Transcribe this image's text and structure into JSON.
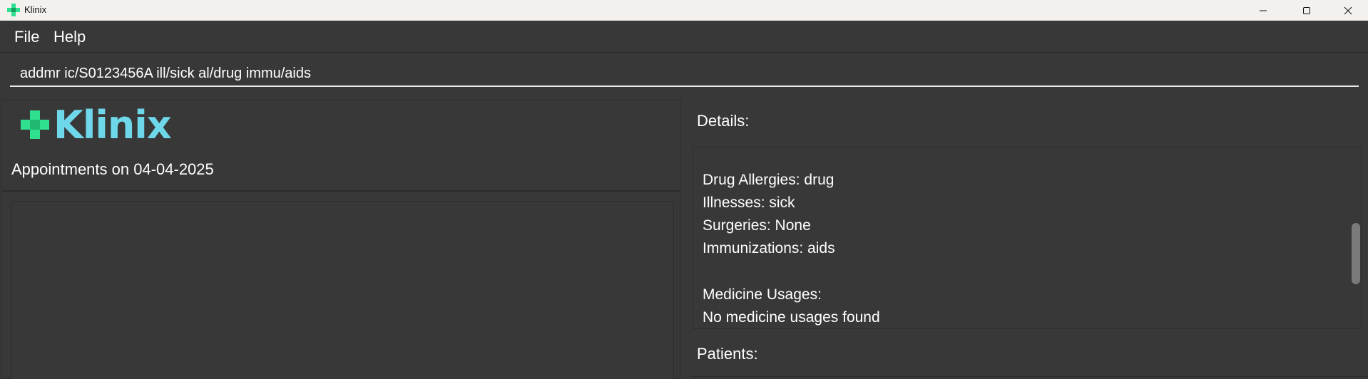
{
  "window": {
    "title": "Klinix",
    "icon": "green-plus-icon",
    "controls": [
      "minimize-icon",
      "maximize-icon",
      "close-icon"
    ]
  },
  "menu": {
    "items": [
      {
        "label": "File"
      },
      {
        "label": "Help"
      }
    ]
  },
  "command": {
    "value": "addmr ic/S0123456A ill/sick al/drug immu/aids"
  },
  "logo": {
    "text": "Klinix",
    "accent_color": "#2fe08f",
    "text_color": "#6fd7ea"
  },
  "appointments": {
    "heading": "Appointments on 04-04-2025"
  },
  "details": {
    "label": "Details:",
    "lines": [
      "Drug Allergies: drug",
      "Illnesses: sick",
      "Surgeries: None",
      "Immunizations: aids",
      "",
      "Medicine Usages:",
      "No medicine usages found"
    ]
  },
  "patients": {
    "label": "Patients:"
  }
}
